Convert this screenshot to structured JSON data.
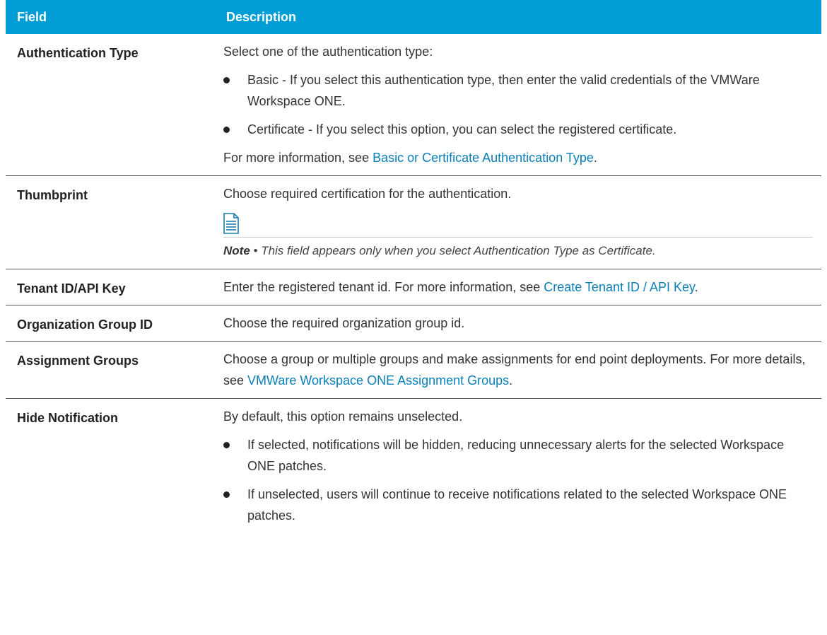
{
  "header": {
    "field": "Field",
    "description": "Description"
  },
  "rows": {
    "auth": {
      "name": "Authentication Type",
      "intro": "Select one of the authentication type:",
      "bullet1": "Basic - If you select this authentication type, then enter the valid credentials of the VMWare Workspace ONE.",
      "bullet2": "Certificate - If you select this option, you can select the registered certificate.",
      "more_prefix": "For more information, see ",
      "more_link": "Basic or Certificate Authentication Type",
      "more_suffix": "."
    },
    "thumb": {
      "name": "Thumbprint",
      "text": "Choose required certification for the authentication.",
      "note_label": "Note",
      "note_sep": " • ",
      "note_text": "This field appears only when you select Authentication Type as Certificate."
    },
    "tenant": {
      "name": "Tenant ID/API Key",
      "prefix": "Enter the registered tenant id. For more information, see ",
      "link": "Create Tenant ID / API Key",
      "suffix": "."
    },
    "org": {
      "name": "Organization Group ID",
      "text": "Choose the required organization group id."
    },
    "assign": {
      "name": "Assignment Groups",
      "prefix": "Choose a group or multiple groups and make assignments for end point deployments. For more details, see ",
      "link": "VMWare Workspace ONE Assignment Groups",
      "suffix": "."
    },
    "hide": {
      "name": "Hide Notification",
      "intro": "By default, this option remains unselected.",
      "bullet1": "If selected, notifications will be hidden, reducing unnecessary alerts for the selected Workspace ONE patches.",
      "bullet2": "If unselected, users will continue to receive notifications related to the selected Workspace ONE patches."
    }
  },
  "icons": {
    "note": "note-document-icon",
    "bullet": "bullet-dot"
  },
  "colors": {
    "header_bg": "#009dd6",
    "link": "#0a7fb8"
  }
}
